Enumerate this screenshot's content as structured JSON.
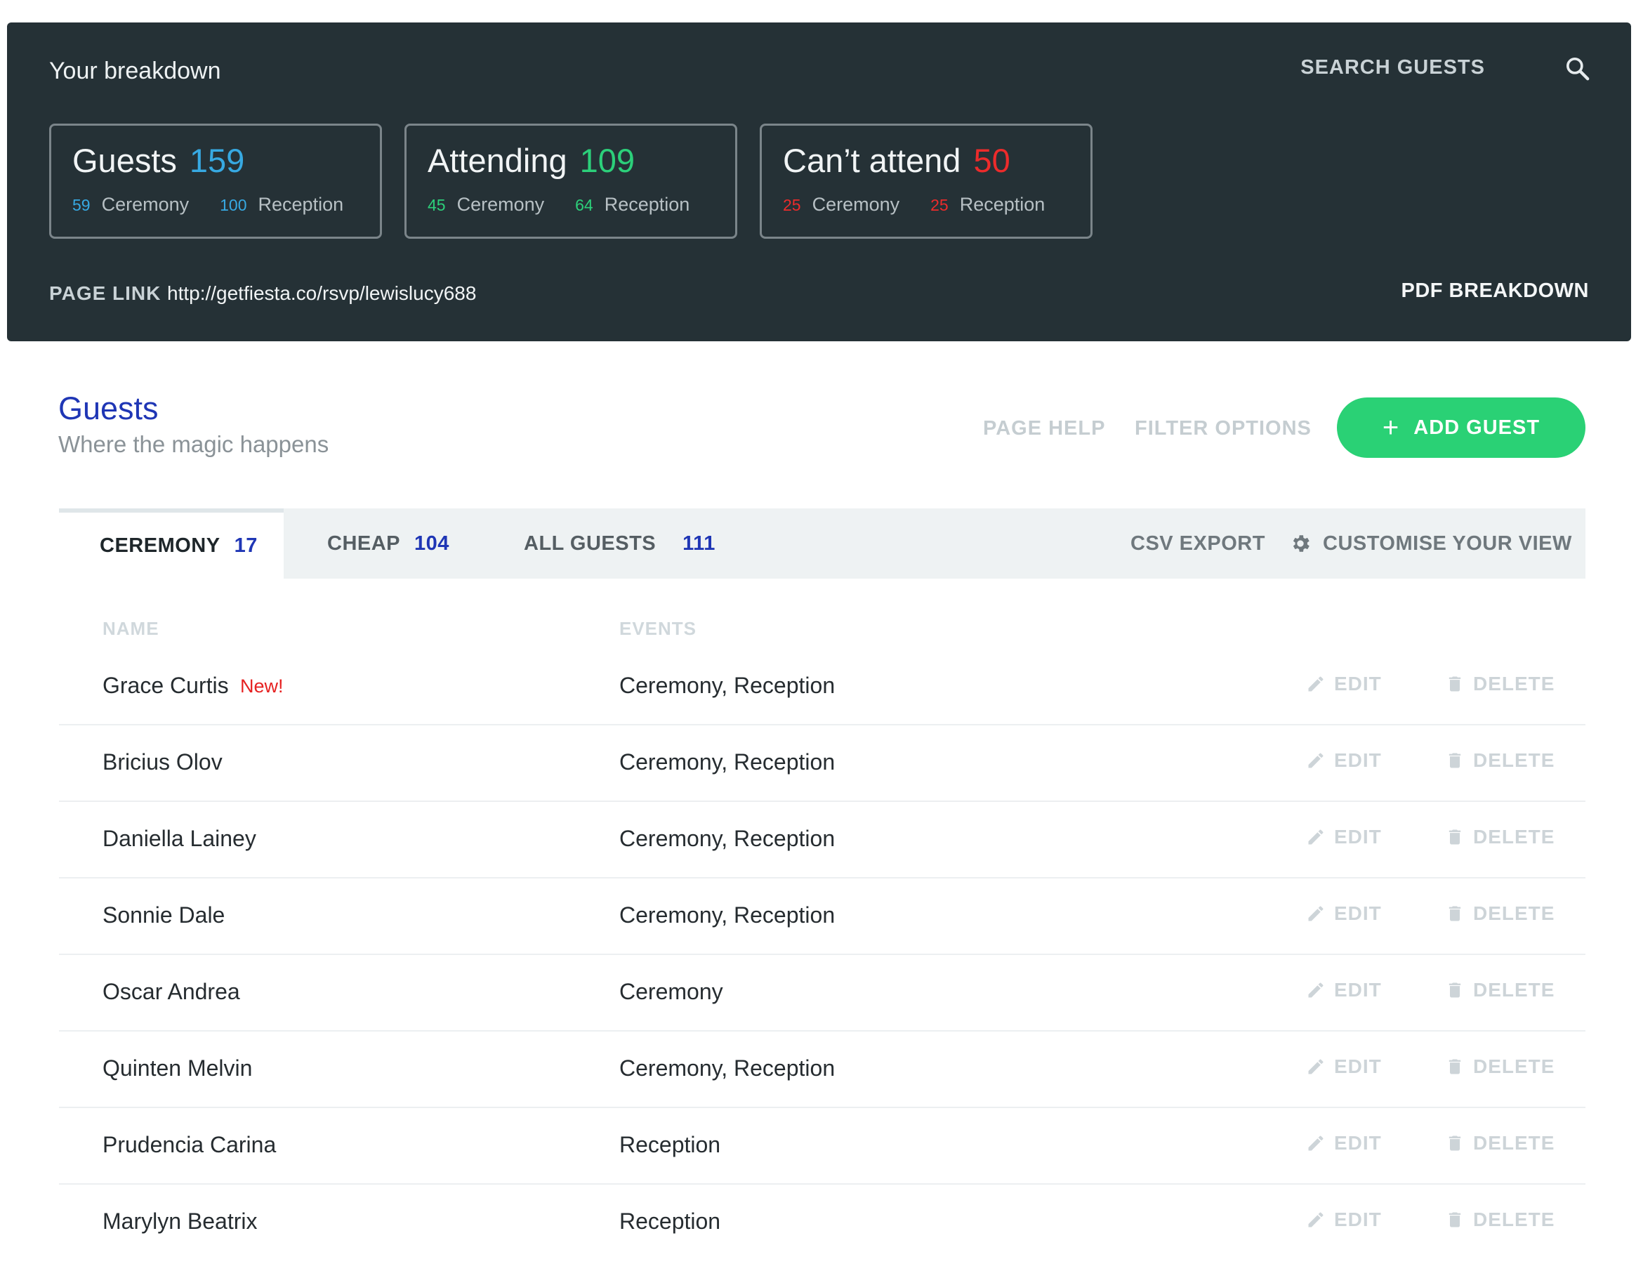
{
  "breakdown": {
    "title": "Your breakdown",
    "search_label": "SEARCH GUESTS",
    "cards": [
      {
        "title": "Guests",
        "count": "159",
        "a_num": "59",
        "a_label": "Ceremony",
        "b_num": "100",
        "b_label": "Reception",
        "color": "#37a9e2"
      },
      {
        "title": "Attending",
        "count": "109",
        "a_num": "45",
        "a_label": "Ceremony",
        "b_num": "64",
        "b_label": "Reception",
        "color": "#2cd07a"
      },
      {
        "title": "Can’t attend",
        "count": "50",
        "a_num": "25",
        "a_label": "Ceremony",
        "b_num": "25",
        "b_label": "Reception",
        "color": "#ec2b2b"
      }
    ],
    "page_link_label": "PAGE LINK",
    "page_link_url": "http://getfiesta.co/rsvp/lewislucy688",
    "pdf_label": "PDF BREAKDOWN"
  },
  "section": {
    "title": "Guests",
    "subtitle": "Where the magic happens",
    "page_help": "PAGE HELP",
    "filter_options": "FILTER OPTIONS",
    "add_guest": "ADD GUEST",
    "add_icon": "+"
  },
  "tabs": [
    {
      "label": "CEREMONY",
      "count": "17",
      "active": true
    },
    {
      "label": "CHEAP",
      "count": "104",
      "active": false
    },
    {
      "label": "ALL GUESTS",
      "count": "111",
      "active": false
    }
  ],
  "tools": {
    "csv_export": "CSV EXPORT",
    "customise": "CUSTOMISE YOUR VIEW"
  },
  "table": {
    "col_name": "NAME",
    "col_events": "EVENTS",
    "edit_label": "EDIT",
    "delete_label": "DELETE",
    "rows": [
      {
        "name": "Grace Curtis",
        "badge": "New!",
        "events": "Ceremony, Reception"
      },
      {
        "name": "Bricius Olov",
        "badge": "",
        "events": "Ceremony, Reception"
      },
      {
        "name": "Daniella Lainey",
        "badge": "",
        "events": "Ceremony, Reception"
      },
      {
        "name": "Sonnie Dale",
        "badge": "",
        "events": "Ceremony, Reception"
      },
      {
        "name": "Oscar Andrea",
        "badge": "",
        "events": "Ceremony"
      },
      {
        "name": "Quinten Melvin",
        "badge": "",
        "events": "Ceremony, Reception"
      },
      {
        "name": "Prudencia Carina",
        "badge": "",
        "events": "Reception"
      },
      {
        "name": "Marylyn Beatrix",
        "badge": "",
        "events": "Reception"
      }
    ]
  },
  "colors": {
    "panel_bg": "#253136",
    "brand_blue": "#1f36b5",
    "add_green": "#2ad175",
    "new_red": "#e62121"
  }
}
